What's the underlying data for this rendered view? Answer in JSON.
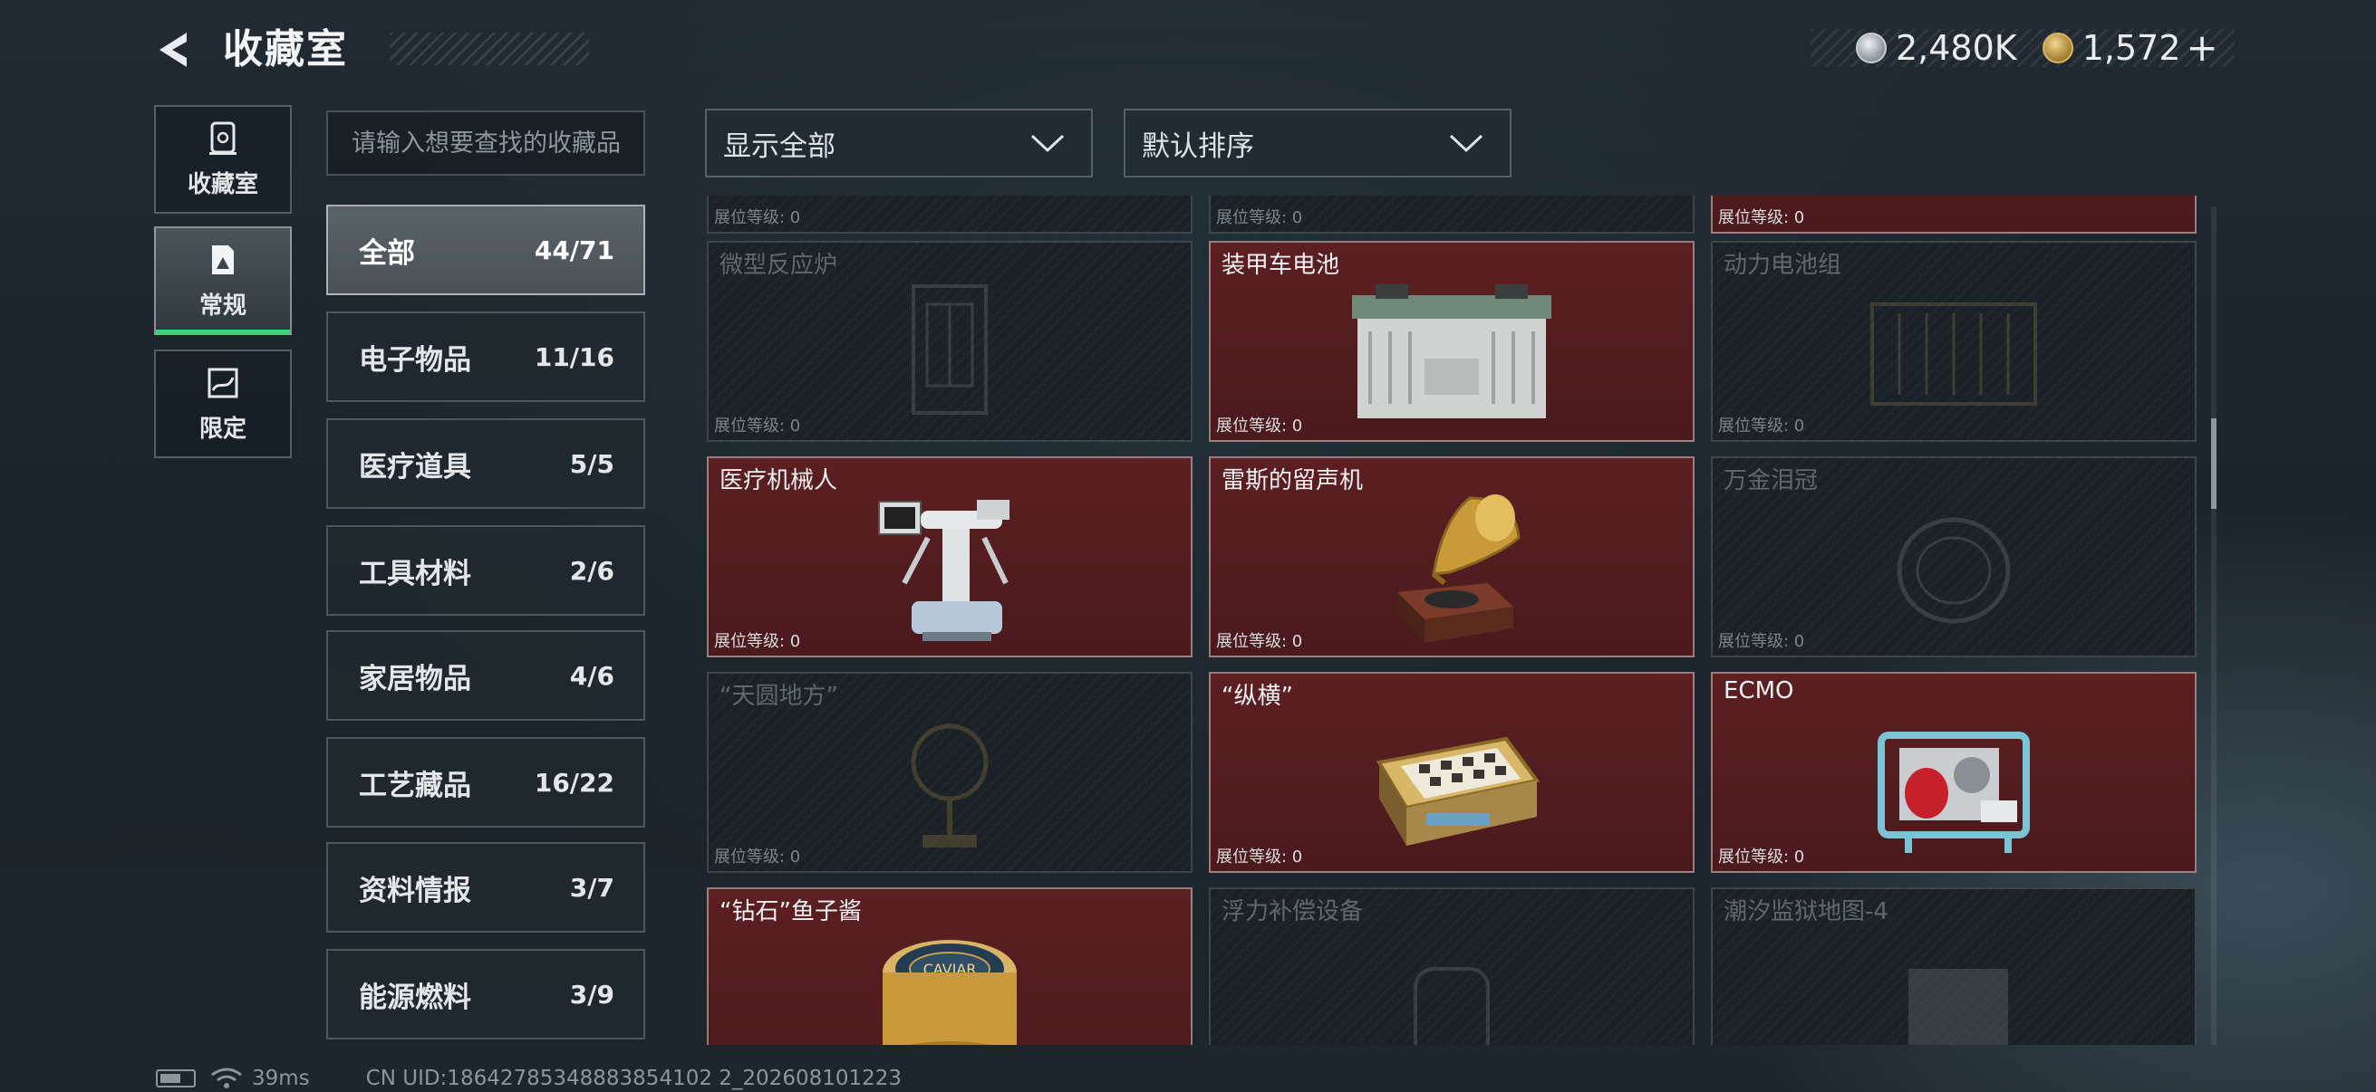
{
  "header": {
    "title": "收藏室",
    "currency_silver": "2,480K",
    "currency_gold": "1,572",
    "plus_label": "+"
  },
  "nav": [
    {
      "label": "收藏室",
      "icon": "vault-icon"
    },
    {
      "label": "常规",
      "icon": "collection-icon",
      "active": true
    },
    {
      "label": "限定",
      "icon": "limited-icon"
    }
  ],
  "search": {
    "placeholder": "请输入想要查找的收藏品"
  },
  "categories": [
    {
      "name": "全部",
      "count": "44/71",
      "active": true
    },
    {
      "name": "电子物品",
      "count": "11/16"
    },
    {
      "name": "医疗道具",
      "count": "5/5"
    },
    {
      "name": "工具材料",
      "count": "2/6"
    },
    {
      "name": "家居物品",
      "count": "4/6"
    },
    {
      "name": "工艺藏品",
      "count": "16/22"
    },
    {
      "name": "资料情报",
      "count": "3/7"
    },
    {
      "name": "能源燃料",
      "count": "3/9"
    }
  ],
  "filters": {
    "show": "显示全部",
    "sort": "默认排序"
  },
  "level_label": "展位等级: 0",
  "items": [
    {
      "name": "",
      "level": "展位等级: 0",
      "owned": false
    },
    {
      "name": "",
      "level": "展位等级: 0",
      "owned": false
    },
    {
      "name": "",
      "level": "展位等级: 0",
      "owned": true
    },
    {
      "name": "微型反应炉",
      "level": "展位等级: 0",
      "owned": false,
      "icon": "reactor-icon"
    },
    {
      "name": "装甲车电池",
      "level": "展位等级: 0",
      "owned": true,
      "icon": "battery-icon"
    },
    {
      "name": "动力电池组",
      "level": "展位等级: 0",
      "owned": false,
      "icon": "battery-pack-icon"
    },
    {
      "name": "医疗机械人",
      "level": "展位等级: 0",
      "owned": true,
      "icon": "medical-robot-icon"
    },
    {
      "name": "雷斯的留声机",
      "level": "展位等级: 0",
      "owned": true,
      "icon": "gramophone-icon"
    },
    {
      "name": "万金泪冠",
      "level": "展位等级: 0",
      "owned": false,
      "icon": "crown-icon"
    },
    {
      "name": "“天圆地方”",
      "level": "展位等级: 0",
      "owned": false,
      "icon": "globe-icon"
    },
    {
      "name": "“纵横”",
      "level": "展位等级: 0",
      "owned": true,
      "icon": "chessboard-icon"
    },
    {
      "name": "ECMO",
      "level": "展位等级: 0",
      "owned": true,
      "icon": "ecmo-icon"
    },
    {
      "name": "“钻石”鱼子酱",
      "level": "",
      "owned": true,
      "icon": "caviar-icon",
      "caviar_label": "CAVIAR"
    },
    {
      "name": "浮力补偿设备",
      "level": "",
      "owned": false,
      "icon": "buoyancy-icon"
    },
    {
      "name": "潮汐监狱地图-4",
      "level": "",
      "owned": false,
      "icon": "map-icon"
    }
  ],
  "footer": {
    "ping": "39ms",
    "uid": "CN UID:18642785348883854102 2_202608101223"
  }
}
